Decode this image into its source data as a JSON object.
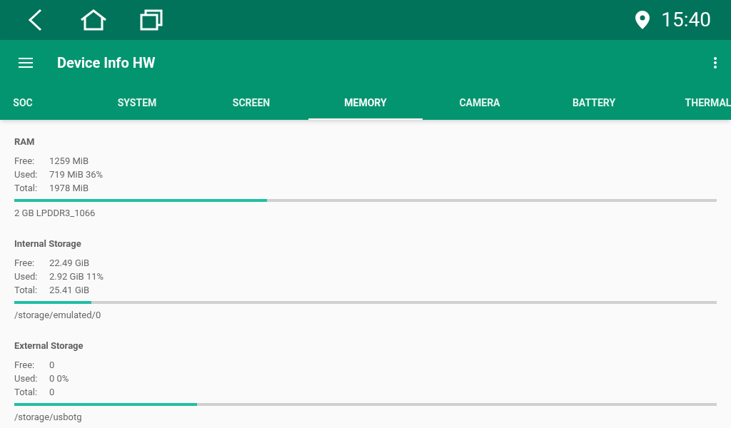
{
  "status_bar": {
    "time": "15:40"
  },
  "app_bar": {
    "title": "Device Info HW"
  },
  "tabs": [
    {
      "label": "SOC",
      "selected": false
    },
    {
      "label": "SYSTEM",
      "selected": false
    },
    {
      "label": "SCREEN",
      "selected": false
    },
    {
      "label": "MEMORY",
      "selected": true
    },
    {
      "label": "CAMERA",
      "selected": false
    },
    {
      "label": "BATTERY",
      "selected": false
    },
    {
      "label": "THERMAL",
      "selected": false
    }
  ],
  "sections": [
    {
      "title": "RAM",
      "rows": [
        {
          "label": "Free:",
          "value": "1259 MiB"
        },
        {
          "label": "Used:",
          "value": "719 MiB 36%"
        },
        {
          "label": "Total:",
          "value": "1978 MiB"
        }
      ],
      "level": 0.36,
      "note": "2 GB LPDDR3_1066"
    },
    {
      "title": "Internal Storage",
      "rows": [
        {
          "label": "Free:",
          "value": "22.49 GiB"
        },
        {
          "label": "Used:",
          "value": "2.92 GiB 11%"
        },
        {
          "label": "Total:",
          "value": "25.41 GiB"
        }
      ],
      "level": 0.11,
      "note": "/storage/emulated/0"
    },
    {
      "title": "External Storage",
      "rows": [
        {
          "label": "Free:",
          "value": "0"
        },
        {
          "label": "Used:",
          "value": "0 0%"
        },
        {
          "label": "Total:",
          "value": "0"
        }
      ],
      "level": 0.26,
      "note": "/storage/usbotg"
    }
  ]
}
